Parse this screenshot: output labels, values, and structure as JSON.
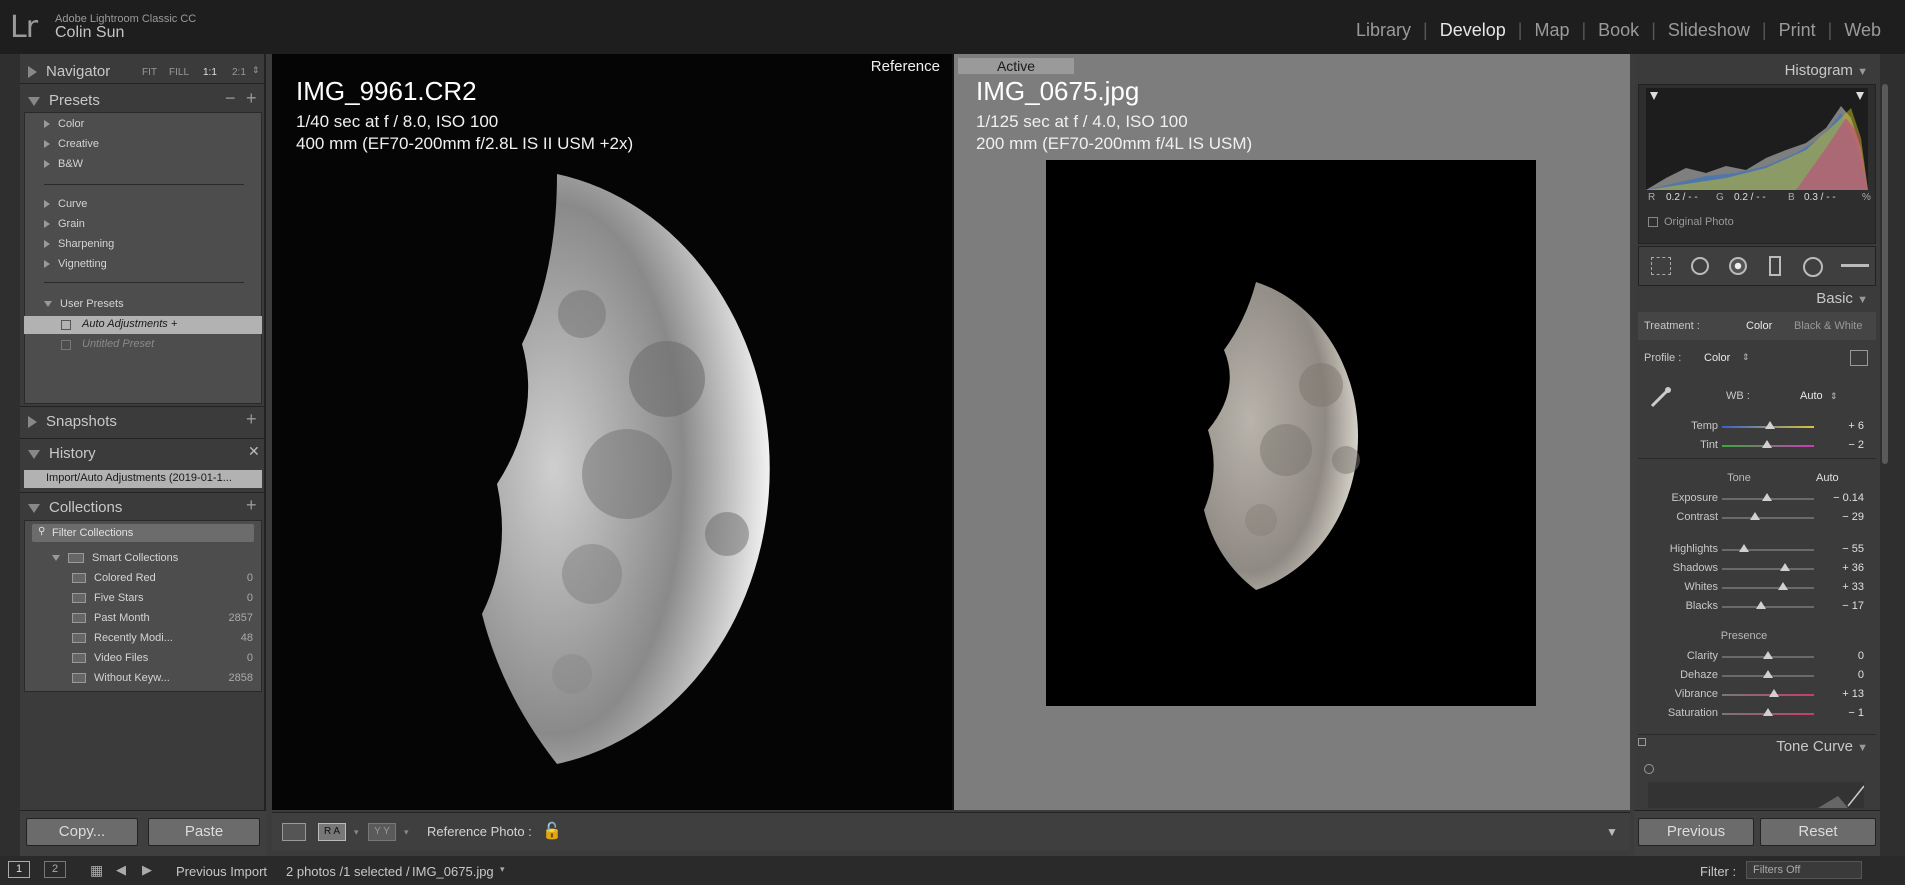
{
  "header": {
    "logo": "Lr",
    "app_name": "Adobe Lightroom Classic CC",
    "user": "Colin Sun",
    "modules": [
      "Library",
      "Develop",
      "Map",
      "Book",
      "Slideshow",
      "Print",
      "Web"
    ],
    "active_module": "Develop"
  },
  "navigator": {
    "title": "Navigator",
    "fit": "FIT",
    "fill": "FILL",
    "one": "1:1",
    "two": "2:1"
  },
  "presets": {
    "title": "Presets",
    "groups": [
      "Color",
      "Creative",
      "B&W",
      "Curve",
      "Grain",
      "Sharpening",
      "Vignetting"
    ],
    "user_group": "User Presets",
    "user_items": [
      "Auto Adjustments +",
      "Untitled Preset"
    ]
  },
  "snapshots": {
    "title": "Snapshots"
  },
  "history": {
    "title": "History",
    "item": "Import/Auto Adjustments (2019-01-1..."
  },
  "collections": {
    "title": "Collections",
    "filter_placeholder": "Filter Collections",
    "smart_label": "Smart Collections",
    "items": [
      {
        "name": "Colored Red",
        "count": "0"
      },
      {
        "name": "Five Stars",
        "count": "0"
      },
      {
        "name": "Past Month",
        "count": "2857"
      },
      {
        "name": "Recently Modi...",
        "count": "48"
      },
      {
        "name": "Video Files",
        "count": "0"
      },
      {
        "name": "Without Keyw...",
        "count": "2858"
      }
    ]
  },
  "left_buttons": {
    "copy": "Copy...",
    "paste": "Paste"
  },
  "reference": {
    "label": "Reference",
    "filename": "IMG_9961.CR2",
    "line1": "1/40 sec at f / 8.0, ISO 100",
    "line2": "400 mm (EF70-200mm f/2.8L IS II USM +2x)"
  },
  "active": {
    "label": "Active",
    "filename": "IMG_0675.jpg",
    "line1": "1/125 sec at f / 4.0, ISO 100",
    "line2": "200 mm (EF70-200mm f/4L IS USM)"
  },
  "toolbar": {
    "ra": "R A",
    "yy": "Y Y",
    "ref_photo": "Reference Photo :"
  },
  "histogram": {
    "title": "Histogram",
    "r_label": "R",
    "r_val": "0.2 / - -",
    "g_label": "G",
    "g_val": "0.2 / - -",
    "b_label": "B",
    "b_val": "0.3 / - -",
    "pct": "%",
    "original_photo": "Original Photo"
  },
  "basic": {
    "title": "Basic",
    "treatment_label": "Treatment :",
    "treatment_color": "Color",
    "treatment_bw": "Black & White",
    "profile_label": "Profile :",
    "profile_value": "Color",
    "wb_label": "WB :",
    "wb_value": "Auto",
    "tone_label": "Tone",
    "tone_auto": "Auto",
    "presence_label": "Presence"
  },
  "sliders": [
    {
      "label": "Temp",
      "value": "+ 6",
      "pos": 0.52
    },
    {
      "label": "Tint",
      "value": "− 2",
      "pos": 0.49
    },
    {
      "label": "Exposure",
      "value": "− 0.14",
      "pos": 0.49
    },
    {
      "label": "Contrast",
      "value": "− 29",
      "pos": 0.36
    },
    {
      "label": "Highlights",
      "value": "− 55",
      "pos": 0.24
    },
    {
      "label": "Shadows",
      "value": "+ 36",
      "pos": 0.68
    },
    {
      "label": "Whites",
      "value": "+ 33",
      "pos": 0.66
    },
    {
      "label": "Blacks",
      "value": "− 17",
      "pos": 0.42
    },
    {
      "label": "Clarity",
      "value": "0",
      "pos": 0.5
    },
    {
      "label": "Dehaze",
      "value": "0",
      "pos": 0.5
    },
    {
      "label": "Vibrance",
      "value": "+ 13",
      "pos": 0.56
    },
    {
      "label": "Saturation",
      "value": "− 1",
      "pos": 0.5
    }
  ],
  "tone_curve": {
    "title": "Tone Curve"
  },
  "right_buttons": {
    "previous": "Previous",
    "reset": "Reset"
  },
  "filmstrip": {
    "page1": "1",
    "page2": "2",
    "source": "Previous Import",
    "status": "2 photos /1 selected /",
    "file": "IMG_0675.jpg",
    "filter_label": "Filter :",
    "filter_value": "Filters Off"
  }
}
